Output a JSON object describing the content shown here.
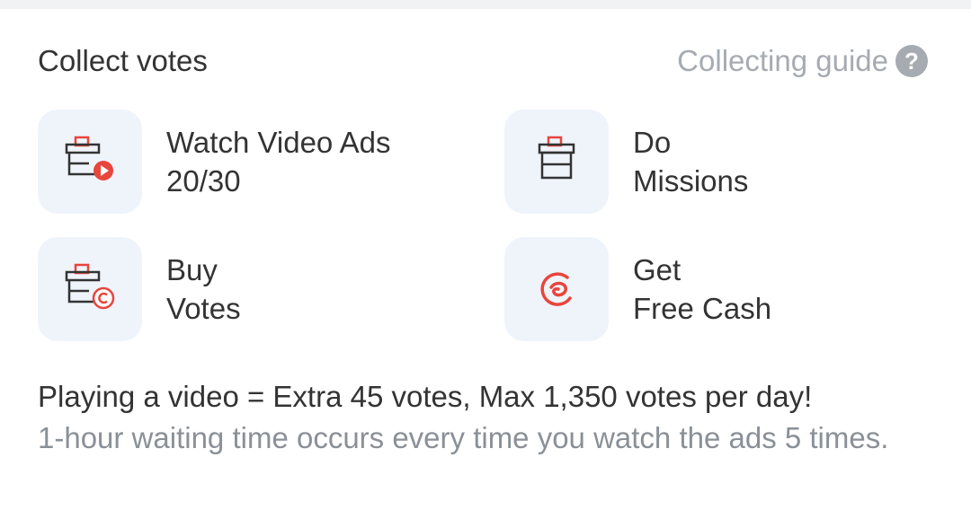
{
  "header": {
    "title": "Collect votes",
    "guide_label": "Collecting guide",
    "guide_icon": "?"
  },
  "options": [
    {
      "icon": "ballot-box-play-icon",
      "line1": "Watch Video Ads",
      "line2": "20/30"
    },
    {
      "icon": "ballot-box-icon",
      "line1": "Do",
      "line2": "Missions"
    },
    {
      "icon": "ballot-box-coin-icon",
      "line1": "Buy",
      "line2": "Votes"
    },
    {
      "icon": "free-cash-icon",
      "line1": "Get",
      "line2": "Free Cash"
    }
  ],
  "info": {
    "main": "Playing a video = Extra 45 votes, Max 1,350 votes per day!",
    "note": "1-hour waiting time occurs every time you watch the ads 5 times."
  },
  "colors": {
    "accent": "#e8453c",
    "icon_stroke": "#333333",
    "tile_background": "#eff4fb",
    "muted_text": "#a6abb2"
  }
}
